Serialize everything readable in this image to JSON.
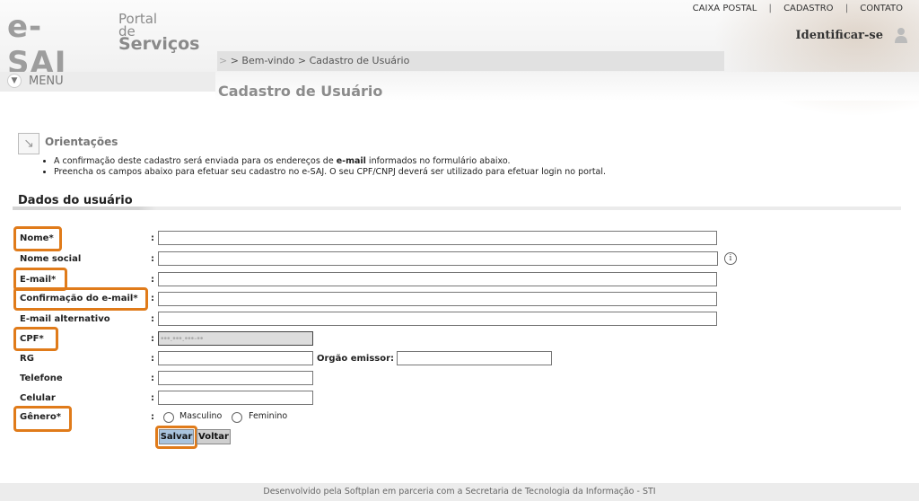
{
  "header": {
    "logo_main": "e-SAJ",
    "logo_portal_line1": "Portal",
    "logo_portal_line2_a": "de",
    "logo_portal_line2_b": "Serviços",
    "links": [
      "CAIXA POSTAL",
      "CADASTRO",
      "CONTATO"
    ],
    "link_separator": "|",
    "identify": "Identificar-se"
  },
  "breadcrumb": {
    "prefix": ">",
    "text": "> Bem-vindo > Cadastro de Usuário"
  },
  "menu": {
    "label": "MENU"
  },
  "page": {
    "title": "Cadastro de Usuário"
  },
  "orientations": {
    "title": "Orientações",
    "items": [
      {
        "before": "A confirmação deste cadastro será enviada para os endereços de ",
        "bold": "e-mail",
        "after": " informados no formulário abaixo."
      },
      {
        "before": "Preencha os campos abaixo para efetuar seu cadastro no e-SAJ. O seu CPF/CNPJ deverá ser utilizado para efetuar login no portal.",
        "bold": "",
        "after": ""
      }
    ]
  },
  "form": {
    "section_title": "Dados do usuário",
    "colon": ":",
    "labels": {
      "nome": "Nome*",
      "nome_social": "Nome social",
      "email": "E-mail*",
      "email_confirm": "Confirmação do e-mail*",
      "email_alt": "E-mail alternativo",
      "cpf": "CPF*",
      "rg": "RG",
      "orgao": "Orgão emissor:",
      "telefone": "Telefone",
      "celular": "Celular",
      "genero": "Gênero*"
    },
    "values": {
      "cpf": "•••.•••.•••-••"
    },
    "gender_options": [
      "Masculino",
      "Feminino"
    ],
    "info_icon": "i",
    "buttons": {
      "save": "Salvar",
      "back": "Voltar"
    }
  },
  "footer": {
    "text": "Desenvolvido pela Softplan em parceria com a Secretaria de Tecnologia da Informação - STI"
  },
  "colors": {
    "highlight": "#e07b1a",
    "save_button": "#a9c4de"
  }
}
